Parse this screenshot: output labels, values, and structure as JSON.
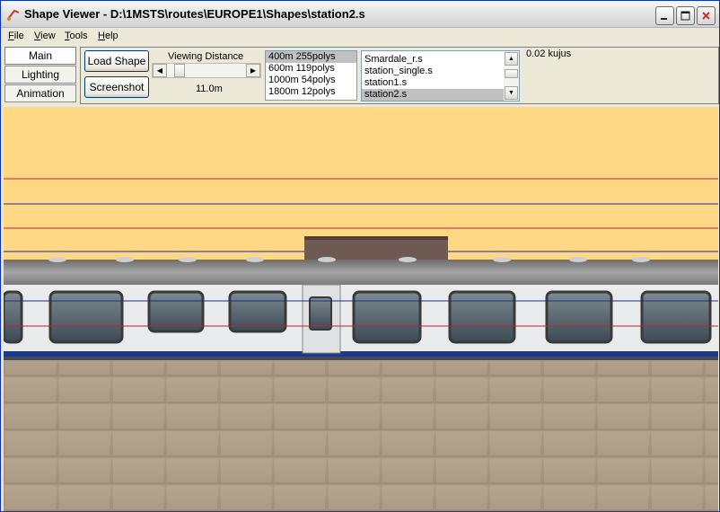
{
  "window": {
    "title": "Shape Viewer - D:\\1MSTS\\routes\\EUROPE1\\Shapes\\station2.s"
  },
  "menu": [
    {
      "label": "File",
      "accel": "F",
      "rest": "ile"
    },
    {
      "label": "View",
      "accel": "V",
      "rest": "iew"
    },
    {
      "label": "Tools",
      "accel": "T",
      "rest": "ools"
    },
    {
      "label": "Help",
      "accel": "H",
      "rest": "elp"
    }
  ],
  "side_tabs": {
    "main": "Main",
    "lighting": "Lighting",
    "animation": "Animation",
    "selected": "Main"
  },
  "toolbar": {
    "load_shape": "Load Shape",
    "screenshot": "Screenshot",
    "viewing_distance_label": "Viewing Distance",
    "viewing_distance_value": "11.0m",
    "viewing_distance_fraction": 0.1,
    "status": "0.02 kujus"
  },
  "lod_list": {
    "items": [
      "400m 255polys",
      "600m 119polys",
      "1000m 54polys",
      "1800m 12polys"
    ],
    "selected_index": 0
  },
  "shape_list": {
    "items": [
      "Smardale_r.s",
      "station_single.s",
      "station1.s",
      "station2.s"
    ],
    "selected_index": 3
  },
  "colors": {
    "sky": "#ffd885",
    "guide_red": "#b02a3a",
    "guide_blue": "#1f2a9a",
    "train_body": "#e9ebec",
    "train_stripe": "#1b3a8a",
    "ground": "#b9a78f"
  },
  "icons": {
    "app": "shape-viewer-app-icon",
    "minimize": "minimize-icon",
    "maximize": "maximize-icon",
    "close": "close-icon"
  }
}
